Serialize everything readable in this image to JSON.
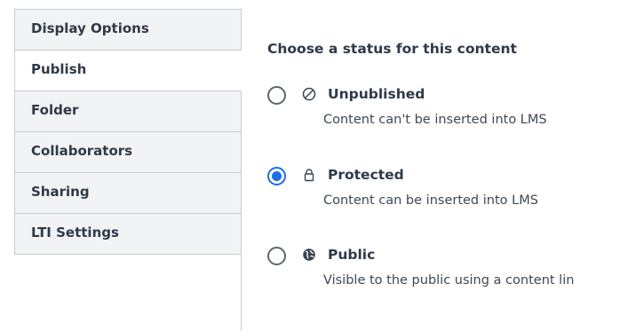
{
  "tabs": [
    {
      "label": "Display Options",
      "active": false
    },
    {
      "label": "Publish",
      "active": true
    },
    {
      "label": "Folder",
      "active": false
    },
    {
      "label": "Collaborators",
      "active": false
    },
    {
      "label": "Sharing",
      "active": false
    },
    {
      "label": "LTI Settings",
      "active": false
    }
  ],
  "publish": {
    "heading": "Choose a status for this content",
    "options": [
      {
        "label": "Unpublished",
        "description": "Content can't be inserted into LMS",
        "icon": "unpublished-icon",
        "selected": false
      },
      {
        "label": "Protected",
        "description": "Content can be inserted into LMS",
        "icon": "lock-icon",
        "selected": true
      },
      {
        "label": "Public",
        "description": "Visible to the public using a content lin",
        "icon": "globe-icon",
        "selected": false
      }
    ]
  },
  "colors": {
    "accent": "#1a6ee6",
    "tab_background": "#f1f3f5",
    "border": "#c9cdd2",
    "text": "#2f3a47"
  }
}
